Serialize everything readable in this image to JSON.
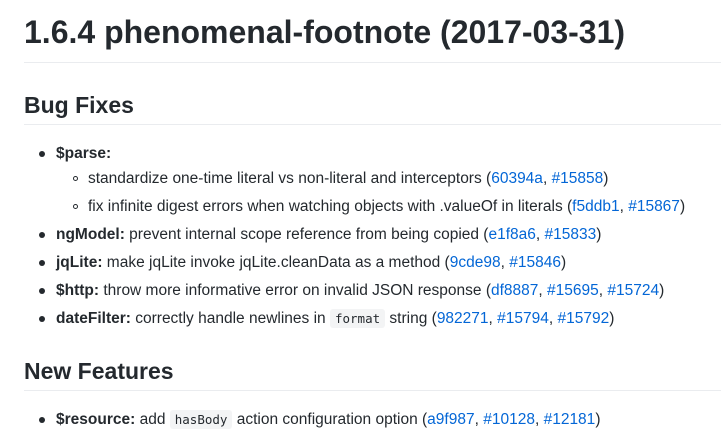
{
  "release": {
    "title": "1.6.4 phenomenal-footnote (2017-03-31)"
  },
  "sections": [
    {
      "heading": "Bug Fixes",
      "items": [
        {
          "scope": "$parse:",
          "text": "",
          "subitems": [
            {
              "text": "standardize one-time literal vs non-literal and interceptors (",
              "links": [
                "60394a",
                "#15858"
              ],
              "suffix": ")"
            },
            {
              "text": "fix infinite digest errors when watching objects with .valueOf in literals (",
              "links": [
                "f5ddb1",
                "#15867"
              ],
              "suffix": ")"
            }
          ]
        },
        {
          "scope": "ngModel:",
          "text": " prevent internal scope reference from being copied (",
          "links": [
            "e1f8a6",
            "#15833"
          ],
          "suffix": ")"
        },
        {
          "scope": "jqLite:",
          "text": " make jqLite invoke jqLite.cleanData as a method (",
          "links": [
            "9cde98",
            "#15846"
          ],
          "suffix": ")"
        },
        {
          "scope": "$http:",
          "text": " throw more informative error on invalid JSON response (",
          "links": [
            "df8887",
            "#15695",
            "#15724"
          ],
          "suffix": ")"
        },
        {
          "scope": "dateFilter:",
          "text_before": " correctly handle newlines in ",
          "code": "format",
          "text_after": " string (",
          "links": [
            "982271",
            "#15794",
            "#15792"
          ],
          "suffix": ")"
        }
      ]
    },
    {
      "heading": "New Features",
      "items": [
        {
          "scope": "$resource:",
          "text_before": " add ",
          "code": "hasBody",
          "text_after": " action configuration option (",
          "links": [
            "a9f987",
            "#10128",
            "#12181"
          ],
          "suffix": ")"
        }
      ]
    }
  ],
  "separators": [
    ", ",
    ", "
  ],
  "colors": {
    "link": "#0366d6",
    "text": "#24292e",
    "rule": "#eaecef",
    "code_bg": "#f3f4f5"
  }
}
